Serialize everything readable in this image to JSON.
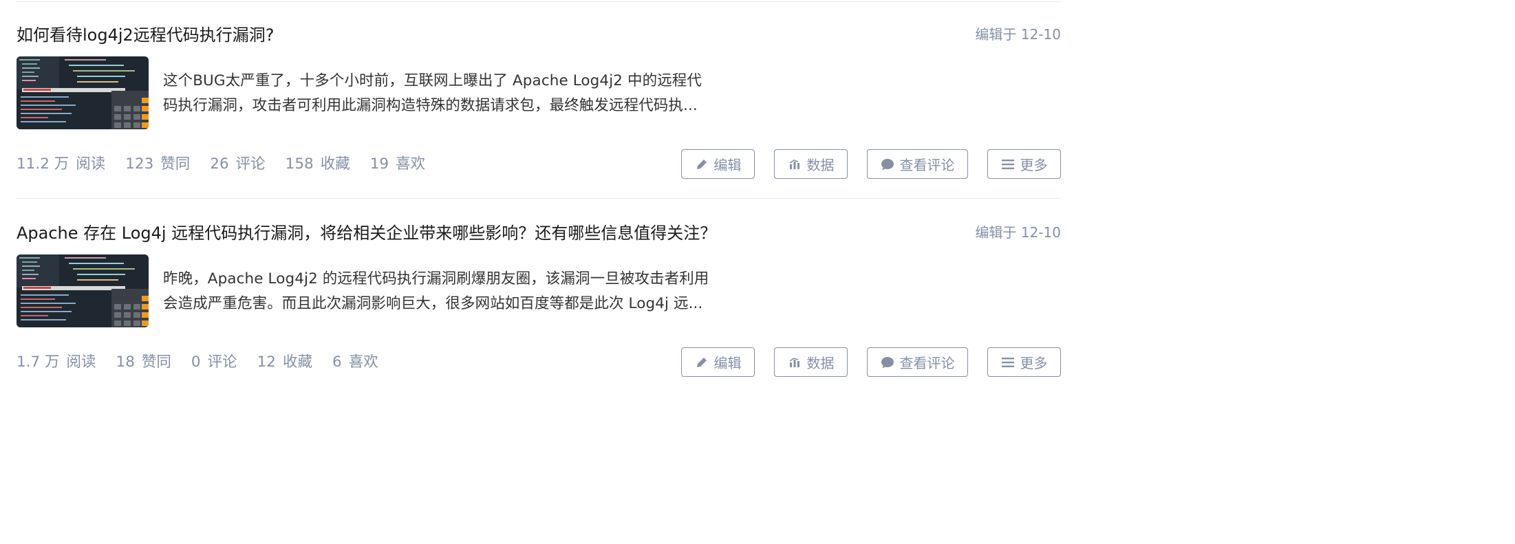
{
  "articles": [
    {
      "title": "如何看待log4j2远程代码执行漏洞?",
      "edited": "编辑于 12-10",
      "excerpt": "这个BUG太严重了，十多个小时前，互联网上曝出了 Apache Log4j2 中的远程代码执行漏洞，攻击者可利用此漏洞构造特殊的数据请求包，最终触发远程代码执...",
      "stats": {
        "reads_num": "11.2 万",
        "reads_label": "阅读",
        "likes_num": "123",
        "likes_label": "赞同",
        "comments_num": "26",
        "comments_label": "评论",
        "favorites_num": "158",
        "favorites_label": "收藏",
        "loves_num": "19",
        "loves_label": "喜欢"
      }
    },
    {
      "title": "Apache 存在 Log4j 远程代码执行漏洞，将给相关企业带来哪些影响？还有哪些信息值得关注？",
      "edited": "编辑于 12-10",
      "excerpt": "昨晚，Apache Log4j2 的远程代码执行漏洞刷爆朋友圈，该漏洞一旦被攻击者利用会造成严重危害。而且此次漏洞影响巨大，很多网站如百度等都是此次 Log4j 远...",
      "stats": {
        "reads_num": "1.7 万",
        "reads_label": "阅读",
        "likes_num": "18",
        "likes_label": "赞同",
        "comments_num": "0",
        "comments_label": "评论",
        "favorites_num": "12",
        "favorites_label": "收藏",
        "loves_num": "6",
        "loves_label": "喜欢"
      }
    }
  ],
  "actions": {
    "edit_label": "编辑",
    "data_label": "数据",
    "comments_label": "查看评论",
    "more_label": "更多"
  },
  "icons": {
    "edit": "pencil-icon",
    "data": "bar-chart-icon",
    "comments": "speech-bubble-icon",
    "more": "hamburger-menu-icon"
  },
  "colors": {
    "muted": "#8590a6",
    "text": "#1a1a1a",
    "divider": "#ebebeb"
  }
}
